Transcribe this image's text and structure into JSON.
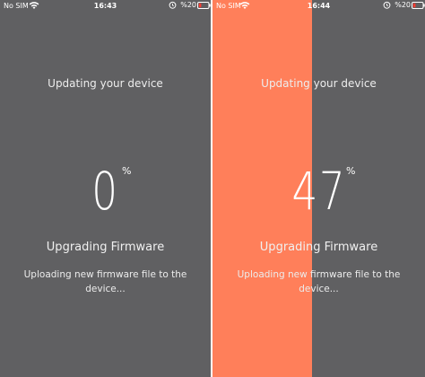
{
  "screens": [
    {
      "status": {
        "carrier": "No SIM",
        "time": "16:43",
        "battery": "%20",
        "icons": [
          "wifi-icon",
          "alarm-icon",
          "battery-low-icon"
        ]
      },
      "heading": "Updating your device",
      "progress_value": "0",
      "progress_fraction": 0,
      "percent_sign": "%",
      "subheading": "Upgrading Firmware",
      "description": "Uploading new firmware file to the device..."
    },
    {
      "status": {
        "carrier": "No SIM",
        "time": "16:44",
        "battery": "%20",
        "icons": [
          "wifi-icon",
          "alarm-icon",
          "battery-low-icon"
        ]
      },
      "heading": "Updating your device",
      "progress_value": "47",
      "progress_fraction": 0.47,
      "percent_sign": "%",
      "subheading": "Upgrading Firmware",
      "description": "Uploading new firmware file to the device..."
    }
  ],
  "colors": {
    "background": "#606062",
    "progress": "#ff7f5a",
    "text": "#ffffff",
    "battery_low": "#ff3b30"
  }
}
